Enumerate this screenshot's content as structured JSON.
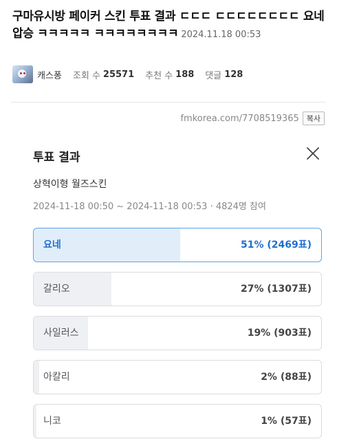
{
  "post": {
    "title": "구마유시방 페이커 스킨 투표 결과 ㄷㄷㄷ ㄷㄷㄷㄷㄷㄷㄷㄷ 요네 압승 ㅋㅋㅋㅋㅋ ㅋㅋㅋㅋㅋㅋㅋㅋ",
    "date": "2024.11.18 00:53",
    "author": "캐스퐁",
    "views_label": "조회 수",
    "views": "25571",
    "likes_label": "추천 수",
    "likes": "188",
    "comments_label": "댓글",
    "comments": "128",
    "url": "fmkorea.com/7708519365",
    "copy_label": "복사"
  },
  "poll": {
    "heading": "투표 결과",
    "subject": "상혁이형 월즈스킨",
    "period": "2024-11-18 00:50 ~ 2024-11-18 00:53 · 4824명 참여",
    "options": [
      {
        "label": "요네",
        "result": "51% (2469표)",
        "percent": 51
      },
      {
        "label": "갈리오",
        "result": "27% (1307표)",
        "percent": 27
      },
      {
        "label": "사일러스",
        "result": "19% (903표)",
        "percent": 19
      },
      {
        "label": "아칼리",
        "result": "2% (88표)",
        "percent": 2
      },
      {
        "label": "니코",
        "result": "1% (57표)",
        "percent": 1
      }
    ]
  },
  "colors": {
    "winner_border": "#5aa3e8",
    "winner_text": "#1f6fd0",
    "winner_fill": "#e1eefa",
    "bar_fill": "#eef0f3"
  },
  "icons": {
    "close": "close-icon",
    "avatar": "avatar"
  }
}
